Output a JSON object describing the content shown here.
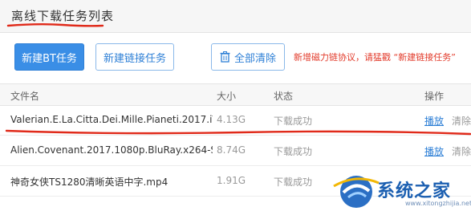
{
  "header": {
    "title": "离线下载任务列表"
  },
  "toolbar": {
    "new_bt_label": "新建BT任务",
    "new_link_label": "新建链接任务",
    "clear_all_label": "全部清除",
    "note": "新增磁力链协议，请猛戳 “新建链接任务”"
  },
  "table": {
    "columns": {
      "name": "文件名",
      "size": "大小",
      "status": "状态",
      "actions": "操作"
    },
    "rows": [
      {
        "name": "Valerian.E.La.Citta.Dei.Mille.Pianeti.2017.iTA...",
        "size": "4.13G",
        "status": "下载成功",
        "play": "播放",
        "delete": "清除"
      },
      {
        "name": "Alien.Covenant.2017.1080p.BluRay.x264-SP...",
        "size": "8.74G",
        "status": "下载成功",
        "play": "播放",
        "delete": "清除"
      },
      {
        "name": "神奇女侠TS1280清晰英语中字.mp4",
        "size": "1.91G",
        "status": "下载成功",
        "play": "",
        "delete": ""
      }
    ]
  },
  "watermark": {
    "text": "系统之家",
    "url": "www.xitongzhijia.net"
  },
  "colors": {
    "accent": "#3a8ee6",
    "link": "#2d7fd6",
    "annotation": "#e23a2a"
  }
}
